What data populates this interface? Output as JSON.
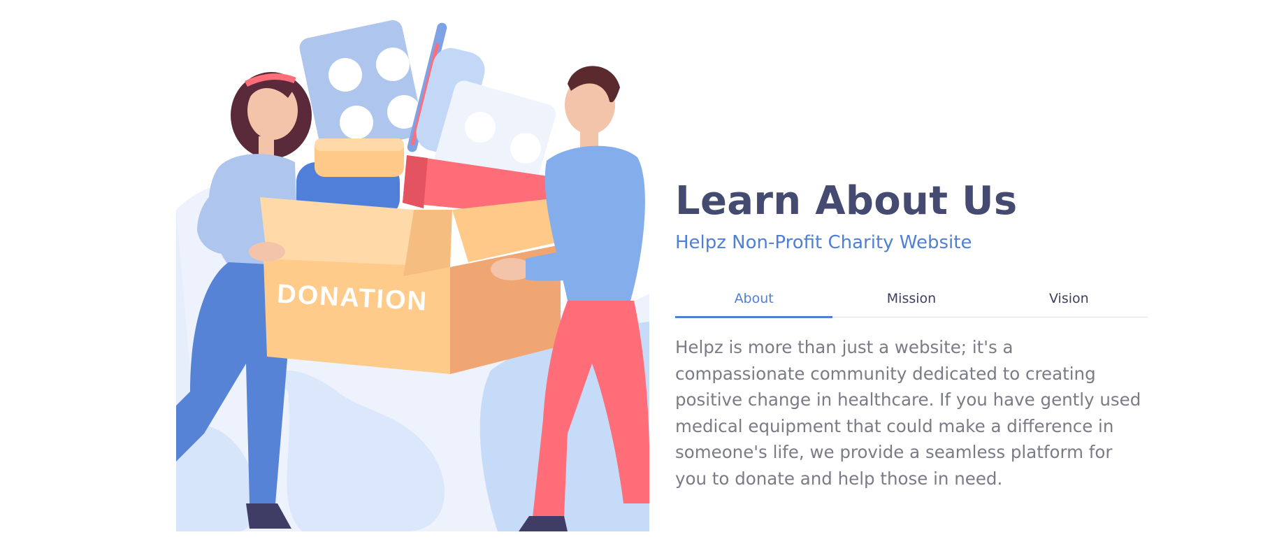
{
  "illustration": {
    "box_text": "DONATION",
    "icon": "donation-box-illustration"
  },
  "main": {
    "title": "Learn About Us",
    "subtitle": "Helpz Non-Profit Charity Website",
    "tabs": [
      {
        "label": "About",
        "active": true
      },
      {
        "label": "Mission",
        "active": false
      },
      {
        "label": "Vision",
        "active": false
      }
    ],
    "body": "Helpz is more than just a website; it's a compassionate community dedicated to creating positive change in healthcare. If you have gently used medical equipment that could make a difference in someone's life, we provide a seamless platform for you to donate and help those in need."
  },
  "colors": {
    "heading": "#454a71",
    "accent": "#4f80d6",
    "body_text": "#7a7b86"
  }
}
